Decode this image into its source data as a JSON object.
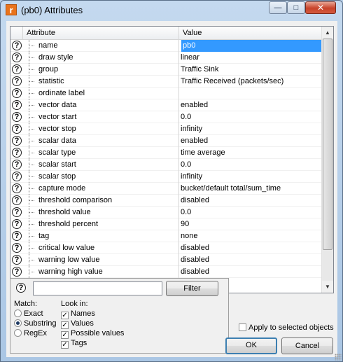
{
  "window": {
    "title": "(pb0) Attributes",
    "app_icon": "r",
    "controls": {
      "minimize": "—",
      "maximize": "□",
      "close": "✕"
    }
  },
  "grid": {
    "columns": {
      "attribute": "Attribute",
      "value": "Value"
    },
    "rows": [
      {
        "attribute": "name",
        "value": "pb0",
        "selected": true
      },
      {
        "attribute": "draw style",
        "value": "linear"
      },
      {
        "attribute": "group",
        "value": "Traffic Sink"
      },
      {
        "attribute": "statistic",
        "value": "Traffic Received (packets/sec)"
      },
      {
        "attribute": "ordinate label",
        "value": ""
      },
      {
        "attribute": "vector data",
        "value": "enabled"
      },
      {
        "attribute": "vector start",
        "value": "0.0"
      },
      {
        "attribute": "vector stop",
        "value": "infinity"
      },
      {
        "attribute": "scalar data",
        "value": "enabled"
      },
      {
        "attribute": "scalar type",
        "value": "time average"
      },
      {
        "attribute": "scalar start",
        "value": "0.0"
      },
      {
        "attribute": "scalar stop",
        "value": "infinity"
      },
      {
        "attribute": "capture mode",
        "value": "bucket/default total/sum_time"
      },
      {
        "attribute": "threshold comparison",
        "value": "disabled"
      },
      {
        "attribute": "threshold value",
        "value": "0.0"
      },
      {
        "attribute": "threshold percent",
        "value": "90"
      },
      {
        "attribute": "tag",
        "value": "none"
      },
      {
        "attribute": "critical low value",
        "value": "disabled"
      },
      {
        "attribute": "warning low value",
        "value": "disabled"
      },
      {
        "attribute": "warning high value",
        "value": "disabled"
      }
    ],
    "help_icon": "?"
  },
  "search": {
    "help_icon": "?",
    "query": "",
    "filter_label": "Filter",
    "match_label": "Match:",
    "match_options": [
      "Exact",
      "Substring",
      "RegEx"
    ],
    "match_selected": "Substring",
    "lookin_label": "Look in:",
    "lookin_options": [
      {
        "label": "Names",
        "checked": true
      },
      {
        "label": "Values",
        "checked": true
      },
      {
        "label": "Possible values",
        "checked": true
      },
      {
        "label": "Tags",
        "checked": true
      }
    ]
  },
  "footer": {
    "apply_label": "Apply to selected objects",
    "apply_checked": false,
    "ok_label": "OK",
    "cancel_label": "Cancel"
  }
}
